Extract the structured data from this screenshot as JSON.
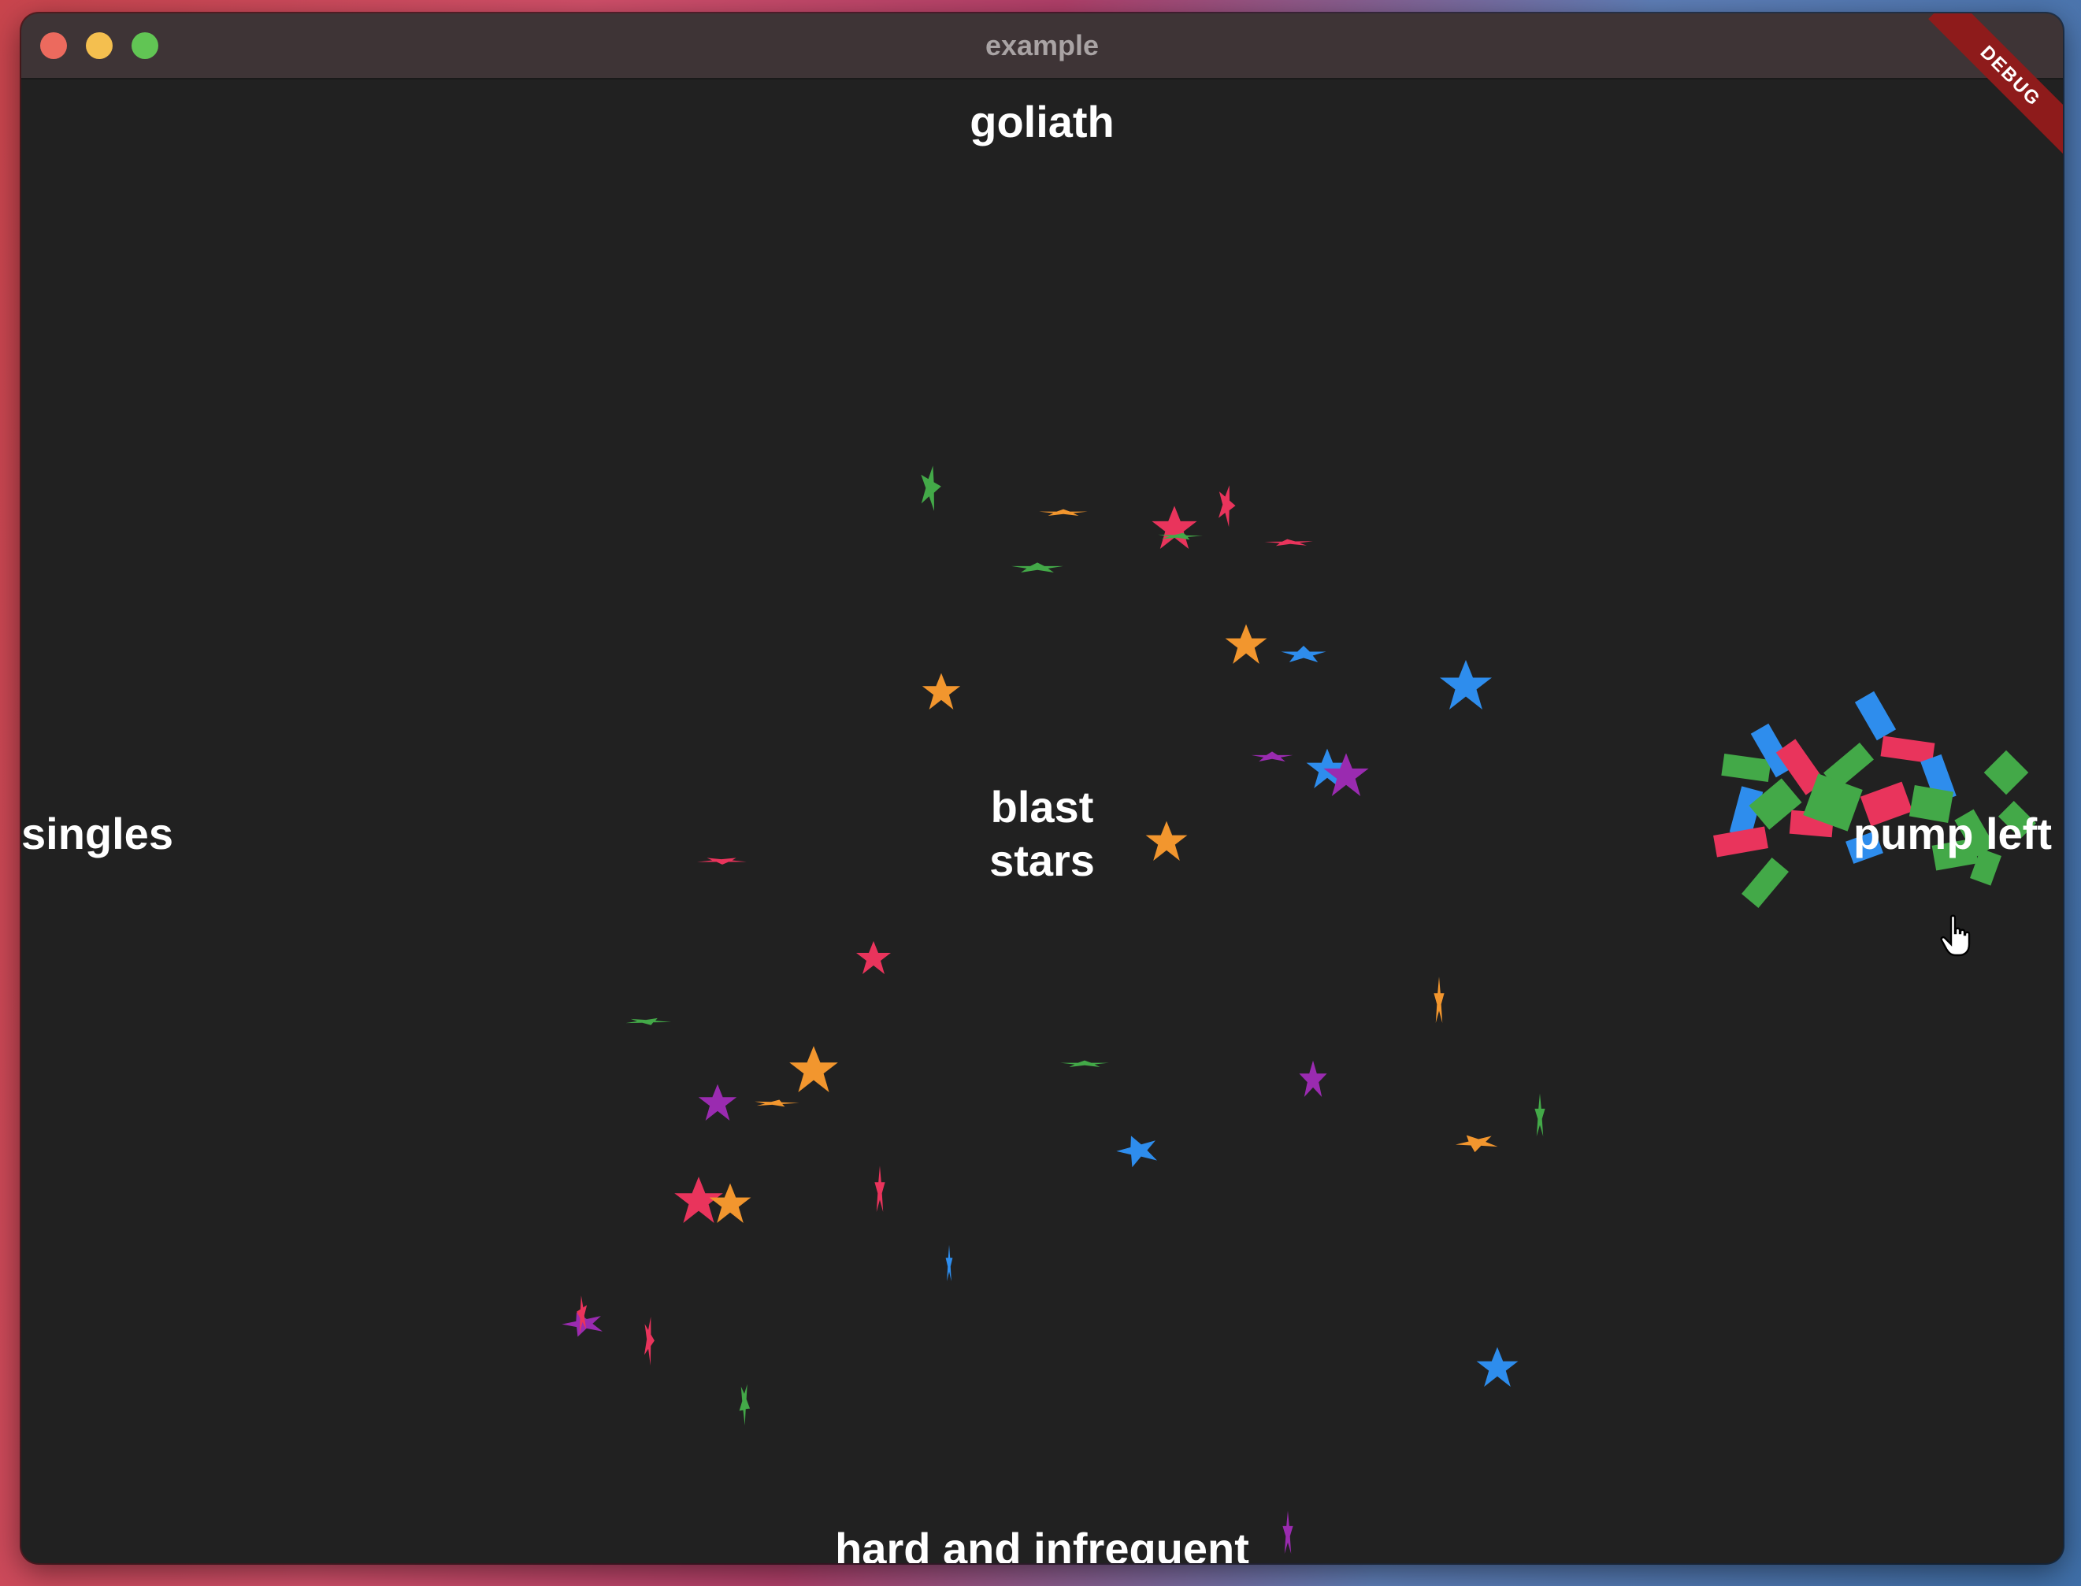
{
  "window": {
    "title": "example"
  },
  "buttons": {
    "goliath": "goliath",
    "blast_stars": "blast\nstars",
    "singles": "singles",
    "pump_left": "pump left",
    "hard_and_infrequent": "hard and infrequent"
  },
  "debug_banner": "DEBUG",
  "colors": {
    "background": "#212121",
    "confetti_red": "#e9345c",
    "confetti_orange": "#f2962e",
    "confetti_green": "#43a948",
    "confetti_blue": "#2e8ded",
    "confetti_purple": "#9a2bb0",
    "debug": "#8e1b1b"
  }
}
